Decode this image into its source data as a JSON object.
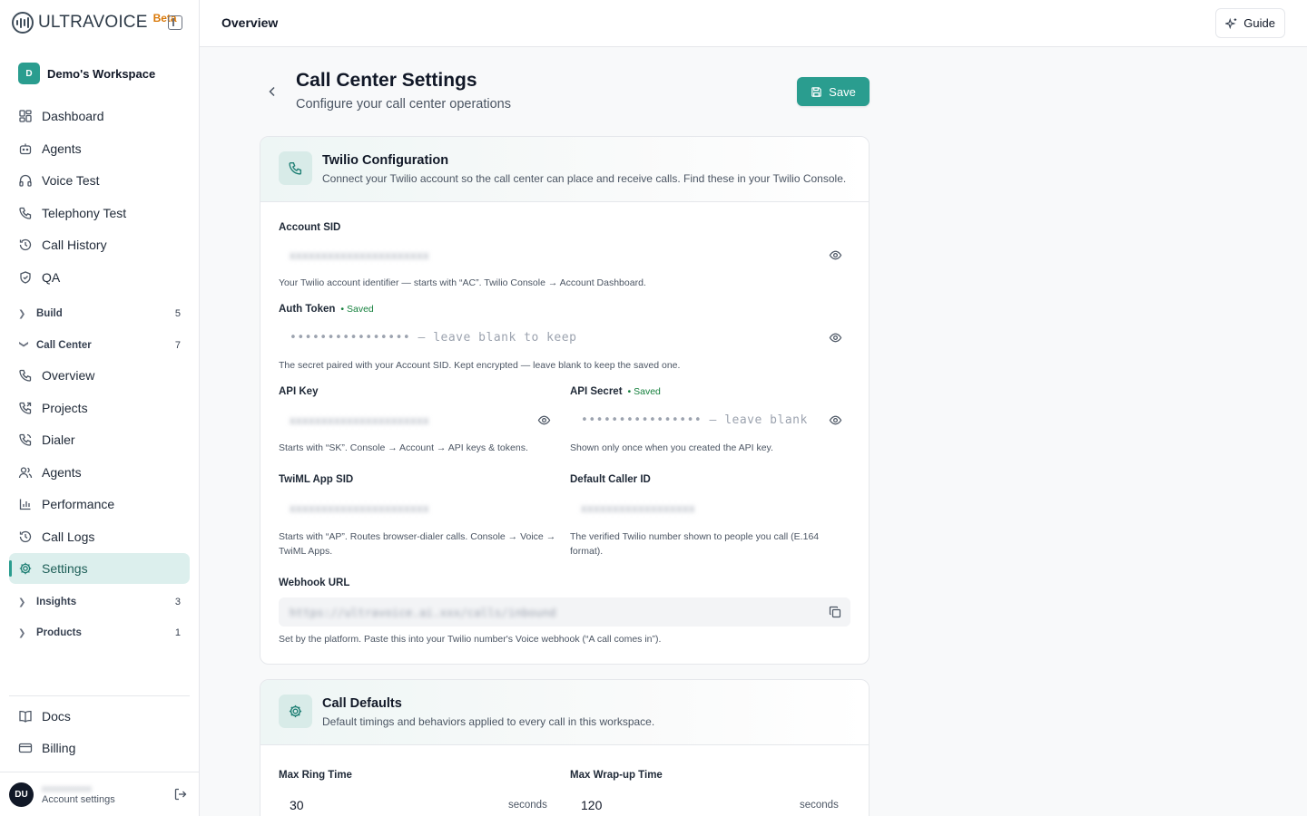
{
  "brand": {
    "name": "ULTRAVOICE",
    "badge": "Beta"
  },
  "workspace": {
    "initial": "D",
    "name": "Demo's Workspace"
  },
  "nav": {
    "top": [
      {
        "label": "Dashboard",
        "icon": "grid-icon"
      },
      {
        "label": "Agents",
        "icon": "bot-icon"
      },
      {
        "label": "Voice Test",
        "icon": "headphones-icon"
      },
      {
        "label": "Telephony Test",
        "icon": "phone-icon"
      },
      {
        "label": "Call History",
        "icon": "history-icon"
      },
      {
        "label": "QA",
        "icon": "shield-check-icon"
      }
    ],
    "groups": {
      "build": {
        "label": "Build",
        "count": "5"
      },
      "call_center": {
        "label": "Call Center",
        "count": "7"
      },
      "insights": {
        "label": "Insights",
        "count": "3"
      },
      "products": {
        "label": "Products",
        "count": "1"
      }
    },
    "call_center_items": [
      {
        "label": "Overview",
        "icon": "phone-icon"
      },
      {
        "label": "Projects",
        "icon": "phone-forward-icon"
      },
      {
        "label": "Dialer",
        "icon": "phone-call-icon"
      },
      {
        "label": "Agents",
        "icon": "users-icon"
      },
      {
        "label": "Performance",
        "icon": "bar-chart-icon"
      },
      {
        "label": "Call Logs",
        "icon": "history-icon"
      },
      {
        "label": "Settings",
        "icon": "gear-icon",
        "active": true
      }
    ],
    "bottom": [
      {
        "label": "Docs",
        "icon": "book-icon"
      },
      {
        "label": "Billing",
        "icon": "credit-card-icon"
      }
    ]
  },
  "account": {
    "initials": "DU",
    "name": "xxxxxxxxxxx",
    "subtitle": "Account settings"
  },
  "topbar": {
    "title": "Overview",
    "guide_label": "Guide"
  },
  "page": {
    "title": "Call Center Settings",
    "subtitle": "Configure your call center operations",
    "save_label": "Save"
  },
  "twilio": {
    "title": "Twilio Configuration",
    "subtitle": "Connect your Twilio account so the call center can place and receive calls. Find these in your Twilio Console.",
    "saved_label": "• Saved",
    "account_sid": {
      "label": "Account SID",
      "value": "xxxxxxxxxxxxxxxxxxxxxx",
      "help": "Your Twilio account identifier — starts with “AC”. Twilio Console → Account Dashboard."
    },
    "auth_token": {
      "label": "Auth Token",
      "placeholder": "•••••••••••••••• — leave blank to keep",
      "help": "The secret paired with your Account SID. Kept encrypted — leave blank to keep the saved one."
    },
    "api_key": {
      "label": "API Key",
      "value": "xxxxxxxxxxxxxxxxxxxxxx",
      "help": "Starts with “SK”. Console → Account → API keys & tokens."
    },
    "api_secret": {
      "label": "API Secret",
      "placeholder": "•••••••••••••••• — leave blank",
      "help": "Shown only once when you created the API key."
    },
    "twiml_app_sid": {
      "label": "TwiML App SID",
      "value": "xxxxxxxxxxxxxxxxxxxxxx",
      "help_line1": "Starts with “AP”. Routes browser-dialer calls. Console → Voice →",
      "help_line2": "TwiML Apps."
    },
    "default_caller_id": {
      "label": "Default Caller ID",
      "value": "xxxxxxxxxxxxxxxxxx",
      "help_line1": "The verified Twilio number shown to people you call (E.164",
      "help_line2": "format)."
    },
    "webhook": {
      "label": "Webhook URL",
      "value": "https://ultravoice.ai.xxx/calls/inbound",
      "help": "Set by the platform. Paste this into your Twilio number's Voice webhook (“A call comes in”)."
    }
  },
  "call_defaults": {
    "title": "Call Defaults",
    "subtitle": "Default timings and behaviors applied to every call in this workspace.",
    "max_ring": {
      "label": "Max Ring Time",
      "value": "30",
      "unit": "seconds"
    },
    "max_wrapup": {
      "label": "Max Wrap-up Time",
      "value": "120",
      "unit": "seconds"
    }
  }
}
